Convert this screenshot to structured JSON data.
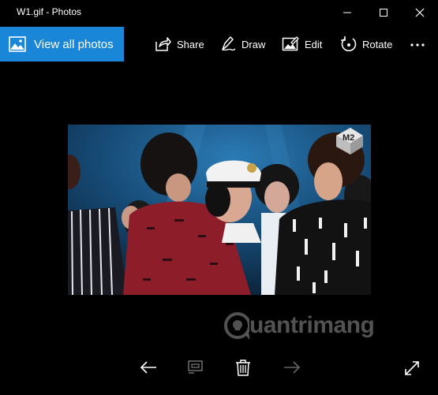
{
  "window": {
    "title": "W1.gif - Photos"
  },
  "toolbar": {
    "view_all": "View all photos",
    "share": "Share",
    "draw": "Draw",
    "edit": "Edit",
    "rotate": "Rotate"
  },
  "photo": {
    "logo_text": "M2"
  },
  "watermark": {
    "text": "uantrimang"
  },
  "colors": {
    "accent": "#1a86d8",
    "background": "#000000"
  }
}
